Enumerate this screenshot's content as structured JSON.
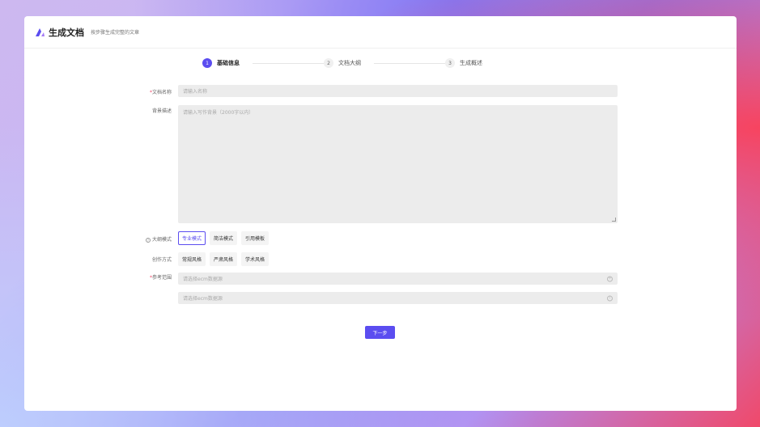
{
  "header": {
    "title": "生成文档",
    "subtitle": "按步骤生成完整的文章"
  },
  "steps": [
    {
      "num": "1",
      "label": "基础信息"
    },
    {
      "num": "2",
      "label": "文档大纲"
    },
    {
      "num": "3",
      "label": "生成概述"
    }
  ],
  "form": {
    "doc_name": {
      "label": "文档名称",
      "placeholder": "请输入名称"
    },
    "background": {
      "label": "背景描述",
      "placeholder": "请输入写作背景（2000字以内）"
    },
    "outline_mode": {
      "label": "大纲模式",
      "options": [
        "专业模式",
        "简洁模式",
        "引用模板"
      ],
      "selected": "专业模式"
    },
    "style": {
      "label": "创作方式",
      "options": [
        "常规风格",
        "严肃风格",
        "学术风格"
      ]
    },
    "reference": {
      "label": "参考范围",
      "placeholder1": "请选择ecm数据源",
      "placeholder2": "请选择ecm数据源"
    }
  },
  "next_label": "下一步",
  "colors": {
    "accent": "#5b4df0",
    "required": "#f0496a"
  }
}
